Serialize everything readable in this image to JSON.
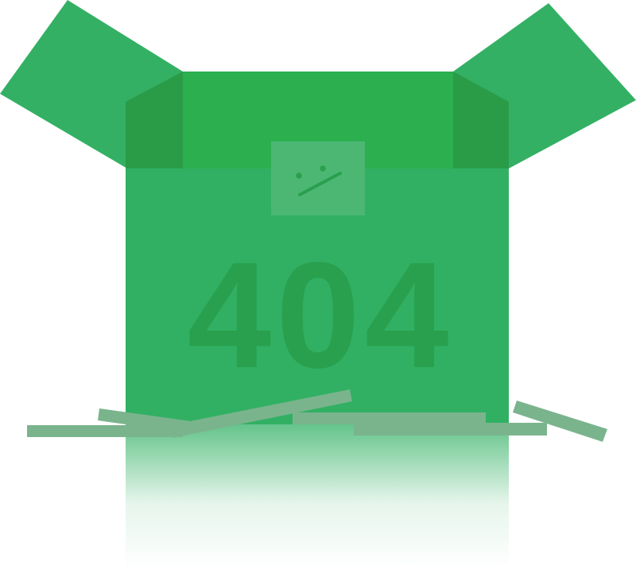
{
  "error_code": "404",
  "colors": {
    "flap": "#33b064",
    "box_front": "#31b063",
    "box_inner": "#2baf4f",
    "box_inner_shadow": "#2a9c47",
    "error_code_text": "#29a04e",
    "label": "#4cb773",
    "label_face": "#2a9f4e",
    "planks": "#7ab48d",
    "background": "#ffffff"
  },
  "icons": {
    "label_face": "confused-face-icon"
  }
}
